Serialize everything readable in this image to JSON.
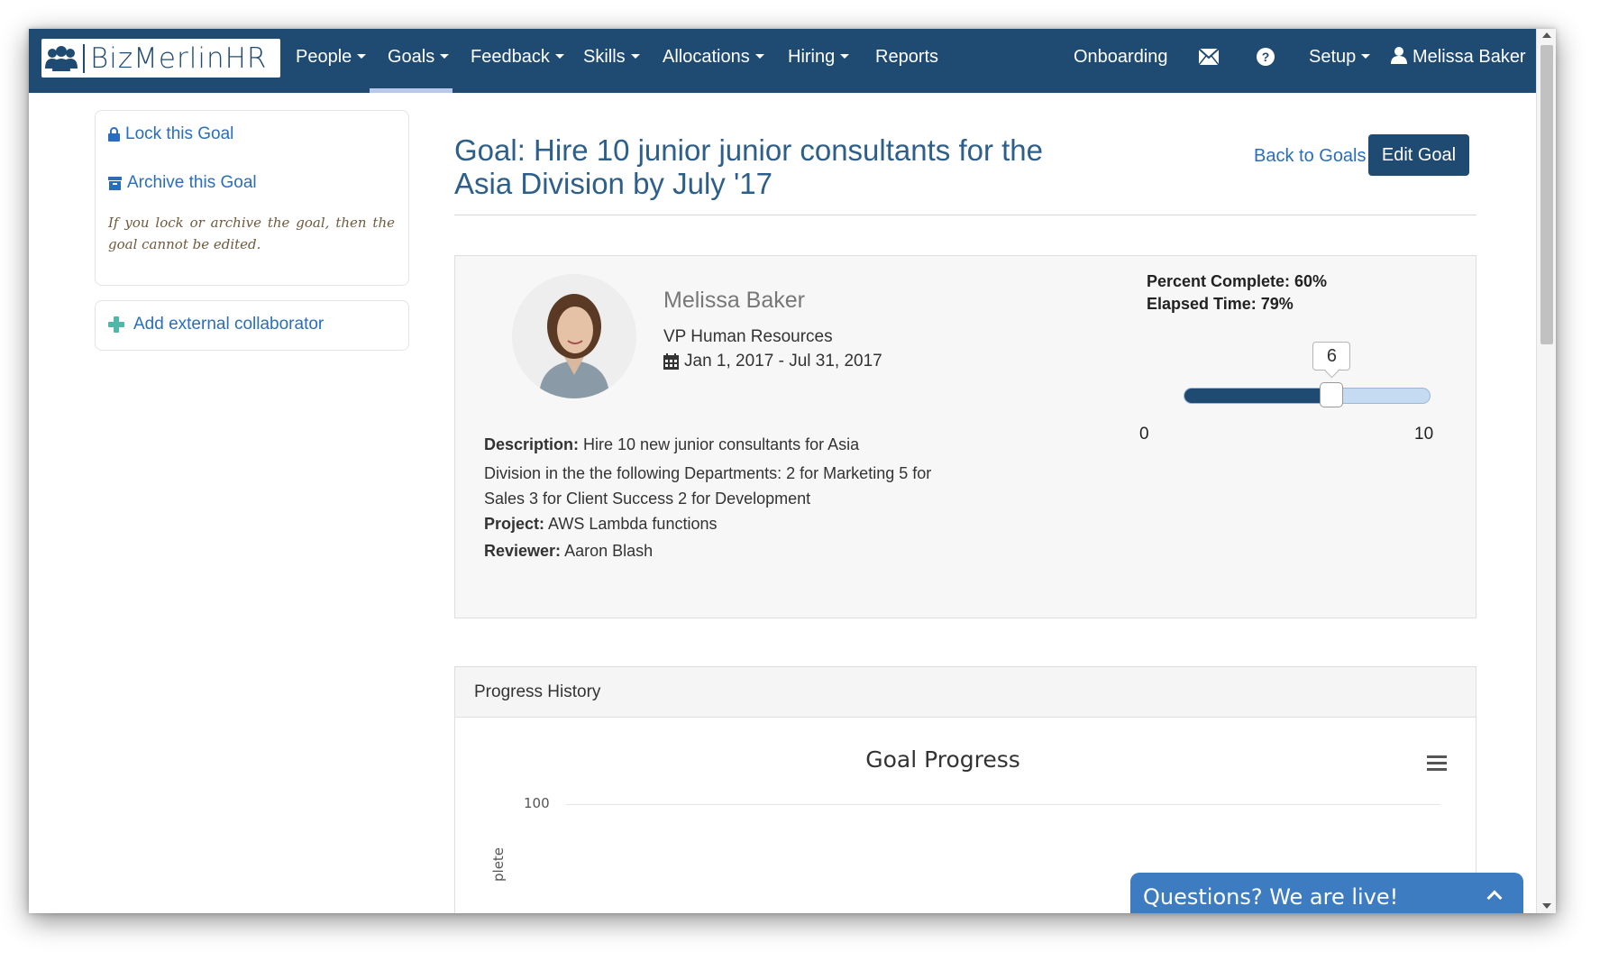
{
  "brand": {
    "name": "BizMerlinHR"
  },
  "nav": {
    "people": "People",
    "goals": "Goals",
    "feedback": "Feedback",
    "skills": "Skills",
    "allocations": "Allocations",
    "hiring": "Hiring",
    "reports": "Reports",
    "onboarding": "Onboarding",
    "setup": "Setup",
    "user": "Melissa Baker",
    "active": "Goals"
  },
  "sidebar": {
    "lock_label": "Lock this Goal",
    "archive_label": "Archive this Goal",
    "note": "If you lock or archive the goal, then the goal cannot be edited.",
    "add_collaborator_label": "Add external collaborator"
  },
  "goal": {
    "title": "Goal: Hire 10 junior junior consultants for the Asia Division by July '17",
    "back_label": "Back to Goals",
    "edit_label": "Edit Goal",
    "owner_name": "Melissa Baker",
    "owner_role": "VP Human Resources",
    "dates": "Jan 1, 2017 - Jul 31, 2017",
    "description_label": "Description:",
    "description_line1": "Hire 10 new junior consultants for Asia",
    "description_rest": "Division in the the following Departments: 2 for Marketing 5 for Sales 3 for Client Success 2 for Development",
    "project_label": "Project:",
    "project_value": "AWS Lambda functions",
    "reviewer_label": "Reviewer:",
    "reviewer_value": "Aaron Blash",
    "percent_complete": "Percent Complete: 60%",
    "elapsed_time": "Elapsed Time: 79%",
    "slider": {
      "min": "0",
      "max": "10",
      "value": "6",
      "fraction": 0.6
    }
  },
  "progress_history": {
    "header": "Progress History",
    "chart_title": "Goal Progress",
    "y_tick_top": "100",
    "y_label_partial": "plete"
  },
  "chat": {
    "label": "Questions? We are live!"
  },
  "colors": {
    "navbar": "#1f4a72",
    "link": "#2a6ebb",
    "button": "#1f4a72",
    "chat": "#3d7cc0",
    "slider_fill": "#1f4a72",
    "slider_track": "#c5dbf2"
  }
}
